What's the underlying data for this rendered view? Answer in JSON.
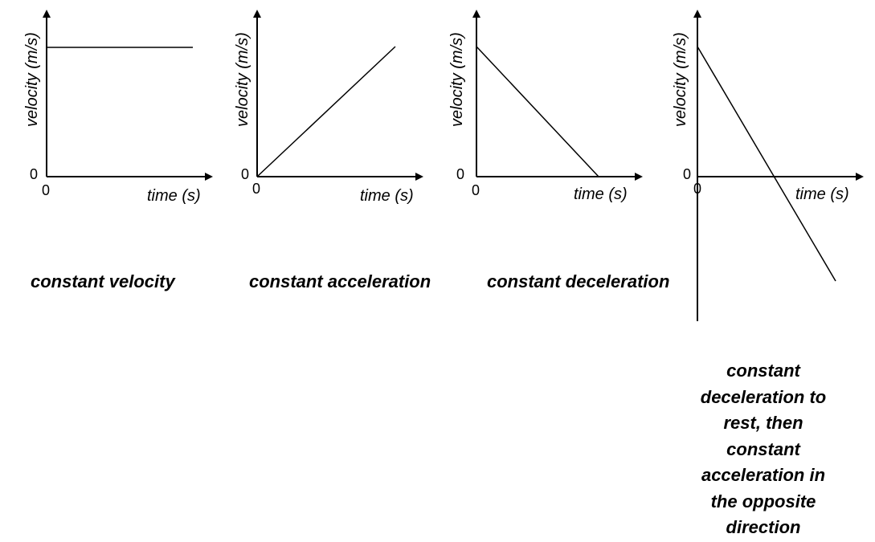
{
  "axes": {
    "y_label": "velocity (m/s)",
    "x_label": "time (s)",
    "origin_x": "0",
    "origin_y": "0"
  },
  "graphs": [
    {
      "id": "constant-velocity",
      "caption": "constant velocity",
      "line": [
        [
          0,
          1
        ],
        [
          1,
          1
        ]
      ]
    },
    {
      "id": "constant-acceleration",
      "caption": "constant acceleration",
      "line": [
        [
          0,
          0
        ],
        [
          1,
          1
        ]
      ]
    },
    {
      "id": "constant-deceleration",
      "caption": "constant deceleration",
      "line": [
        [
          0,
          1
        ],
        [
          1,
          0
        ]
      ]
    },
    {
      "id": "deceleration-then-acceleration-opposite",
      "caption": "constant deceleration to rest, then constant acceleration in the opposite direction",
      "line": [
        [
          0,
          1
        ],
        [
          1,
          -1
        ]
      ]
    }
  ]
}
